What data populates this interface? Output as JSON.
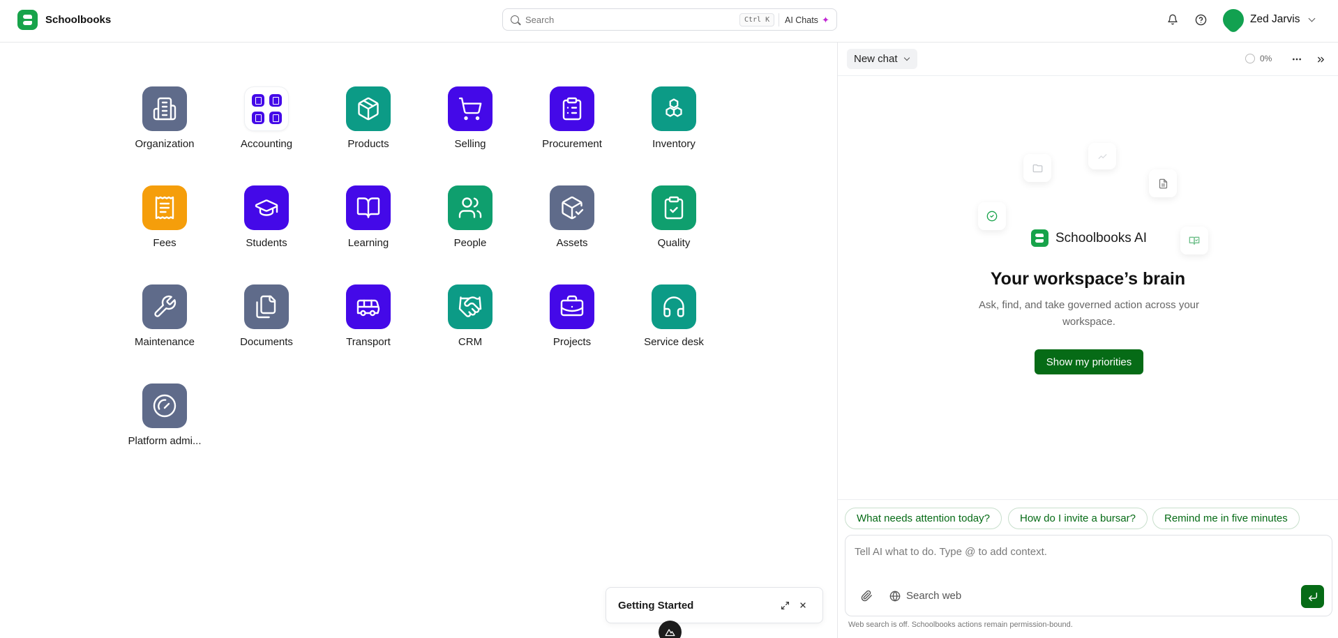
{
  "header": {
    "brand_name": "Schoolbooks",
    "search_placeholder": "Search",
    "search_shortcut": "Ctrl K",
    "ai_chats_label": "AI Chats",
    "user_name": "Zed Jarvis"
  },
  "apps": [
    {
      "label": "Organization",
      "icon": "building-icon",
      "color": "#5f6b8a"
    },
    {
      "label": "Accounting",
      "icon": "accounting-grid-icon",
      "color": "#4409e8"
    },
    {
      "label": "Products",
      "icon": "package-icon",
      "color": "#0c9b86"
    },
    {
      "label": "Selling",
      "icon": "cart-icon",
      "color": "#4409e8"
    },
    {
      "label": "Procurement",
      "icon": "clipboard-list-icon",
      "color": "#4409e8"
    },
    {
      "label": "Inventory",
      "icon": "boxes-icon",
      "color": "#0c9b86"
    },
    {
      "label": "Fees",
      "icon": "receipt-icon",
      "color": "#f59e0b"
    },
    {
      "label": "Students",
      "icon": "graduation-cap-icon",
      "color": "#4409e8"
    },
    {
      "label": "Learning",
      "icon": "book-open-icon",
      "color": "#4409e8"
    },
    {
      "label": "People",
      "icon": "users-icon",
      "color": "#0f9f6e"
    },
    {
      "label": "Assets",
      "icon": "package-check-icon",
      "color": "#5f6b8a"
    },
    {
      "label": "Quality",
      "icon": "clipboard-check-icon",
      "color": "#0f9f6e"
    },
    {
      "label": "Maintenance",
      "icon": "wrench-icon",
      "color": "#5f6b8a"
    },
    {
      "label": "Documents",
      "icon": "files-icon",
      "color": "#5f6b8a"
    },
    {
      "label": "Transport",
      "icon": "bus-icon",
      "color": "#4409e8"
    },
    {
      "label": "CRM",
      "icon": "handshake-icon",
      "color": "#0c9b86"
    },
    {
      "label": "Projects",
      "icon": "briefcase-icon",
      "color": "#4409e8"
    },
    {
      "label": "Service desk",
      "icon": "headphones-icon",
      "color": "#0c9b86"
    },
    {
      "label": "Platform admi...",
      "icon": "gauge-icon",
      "color": "#5f6b8a"
    }
  ],
  "chat": {
    "new_chat_label": "New chat",
    "usage_percent": "0%",
    "ai_brand_name": "Schoolbooks AI",
    "hero_title": "Your workspace’s brain",
    "hero_subtitle": "Ask, find, and take governed action across your workspace.",
    "priorities_button": "Show my priorities",
    "suggestions": [
      "What needs attention today?",
      "How do I invite a bursar?",
      "Remind me in five minutes"
    ],
    "composer_placeholder": "Tell AI what to do. Type @ to add context.",
    "search_web_label": "Search web",
    "footnote": "Web search is off. Schoolbooks actions remain permission-bound."
  },
  "getting_started": {
    "title": "Getting Started"
  },
  "colors": {
    "brand_green": "#17a34a",
    "action_green": "#066b16",
    "indigo": "#4409e8",
    "teal": "#0c9b86",
    "slate": "#5f6b8a",
    "amber": "#f59e0b"
  }
}
